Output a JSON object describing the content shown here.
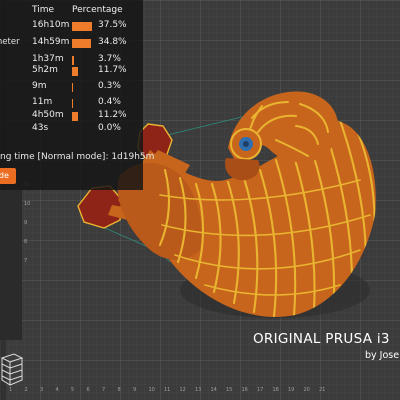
{
  "stats": {
    "header_time": "Time",
    "header_percentage": "Percentage",
    "rows": [
      {
        "label": "",
        "time": "16h10m",
        "percentage": "37.5%",
        "bar": 0.375
      },
      {
        "label": "meter",
        "time": "14h59m",
        "percentage": "34.8%",
        "bar": 0.348
      },
      {
        "label": "",
        "time": "1h37m",
        "percentage": "3.7%",
        "bar": 0.037
      },
      {
        "label": "",
        "time": "5h2m",
        "percentage": "11.7%",
        "bar": 0.117
      },
      {
        "label": "ll",
        "time": "9m",
        "percentage": "0.3%",
        "bar": 0.003
      },
      {
        "label": "",
        "time": "11m",
        "percentage": "0.4%",
        "bar": 0.004
      },
      {
        "label": "",
        "time": "4h50m",
        "percentage": "11.2%",
        "bar": 0.112
      },
      {
        "label": "",
        "time": "43s",
        "percentage": "0.0%",
        "bar": 0.0
      }
    ],
    "total_time": "ng time [Normal mode]:  1d19h5m",
    "mode_button_label": "ode"
  },
  "overlay": {
    "printer_caption": "ORIGINAL PRUSA i3",
    "author_caption": "by Jose"
  },
  "axis": {
    "x_ticks": [
      "1",
      "2",
      "3",
      "4",
      "5",
      "6",
      "7",
      "8",
      "9",
      "10",
      "11",
      "12",
      "13",
      "14",
      "15",
      "16",
      "17",
      "18",
      "19",
      "20",
      "21"
    ],
    "y_ticks": [
      "11",
      "10",
      "9",
      "8",
      "7"
    ]
  },
  "colors": {
    "bed": "#3c3c3c",
    "grid": "#5a5a5a",
    "model_orange": "#c8651c",
    "model_yellow": "#e9b430",
    "accent": "#ee7c2a",
    "support_red": "#8e2418"
  }
}
